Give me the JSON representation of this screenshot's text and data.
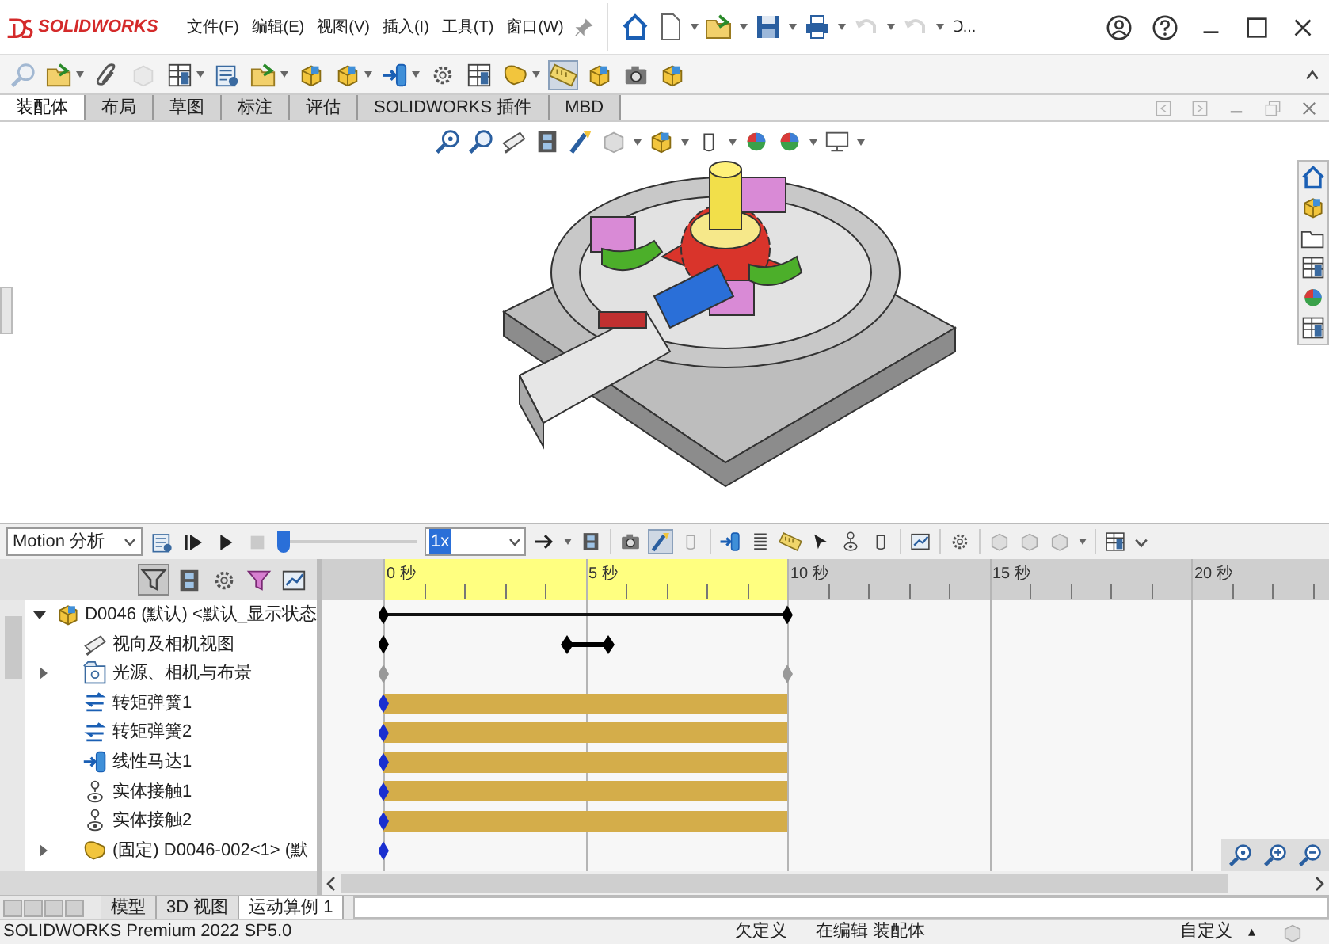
{
  "title_bar": {
    "brand": "SOLIDWORKS",
    "menus": [
      "文件(F)",
      "编辑(E)",
      "视图(V)",
      "插入(I)",
      "工具(T)",
      "窗口(W)"
    ],
    "search_stub": "Ↄ..."
  },
  "tabs": [
    {
      "label": "装配体",
      "selected": true
    },
    {
      "label": "布局",
      "selected": false
    },
    {
      "label": "草图",
      "selected": false
    },
    {
      "label": "标注",
      "selected": false
    },
    {
      "label": "评估",
      "selected": false
    },
    {
      "label": "SOLIDWORKS 插件",
      "selected": false
    },
    {
      "label": "MBD",
      "selected": false
    }
  ],
  "motion_toolbar": {
    "study_type": "Motion 分析",
    "playback_slider": {
      "level": 0
    },
    "speed": "1x"
  },
  "tree": [
    {
      "label": "D0046 (默认) <默认_显示状态",
      "kind": "assembly",
      "expandable": true,
      "expanded": true,
      "track": {
        "kind": "span"
      }
    },
    {
      "label": "视向及相机视图",
      "kind": "camera",
      "expandable": false,
      "track": {
        "kind": "view"
      }
    },
    {
      "label": "光源、相机与布景",
      "kind": "lights",
      "expandable": true,
      "expanded": false,
      "track": {
        "kind": "inactive"
      }
    },
    {
      "label": "转矩弹簧1",
      "kind": "spring",
      "expandable": false,
      "track": {
        "kind": "band"
      }
    },
    {
      "label": "转矩弹簧2",
      "kind": "spring",
      "expandable": false,
      "track": {
        "kind": "band"
      }
    },
    {
      "label": "线性马达1",
      "kind": "motor",
      "expandable": false,
      "track": {
        "kind": "band"
      }
    },
    {
      "label": "实体接触1",
      "kind": "contact",
      "expandable": false,
      "track": {
        "kind": "band"
      }
    },
    {
      "label": "实体接触2",
      "kind": "contact",
      "expandable": false,
      "track": {
        "kind": "band"
      }
    },
    {
      "label": "(固定) D0046-002<1> (默",
      "kind": "part",
      "expandable": true,
      "expanded": false,
      "track": {
        "kind": "key"
      }
    }
  ],
  "timeline": {
    "ticks": [
      "0 秒",
      "5 秒",
      "10 秒",
      "15 秒",
      "20 秒"
    ]
  },
  "bottom_tabs": [
    {
      "label": "模型",
      "selected": false
    },
    {
      "label": "3D 视图",
      "selected": false
    },
    {
      "label": "运动算例 1",
      "selected": true
    }
  ],
  "status_bar": {
    "product": "SOLIDWORKS Premium 2022 SP5.0",
    "definition": "欠定义",
    "mode": "在编辑 装配体",
    "units": "自定义",
    "caret": "▴"
  }
}
